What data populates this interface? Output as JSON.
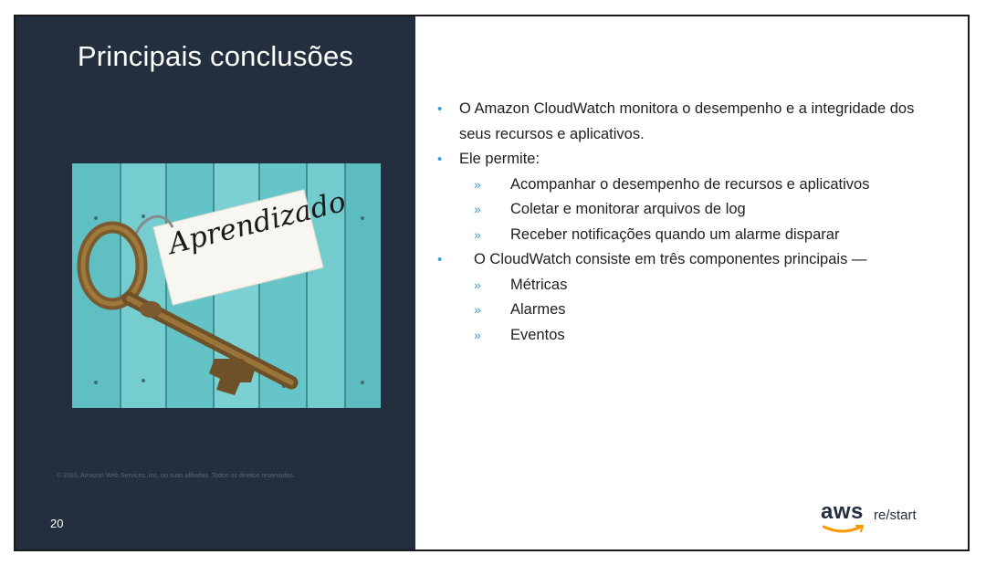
{
  "slide": {
    "title": "Principais conclusões",
    "image_label": "Aprendizado",
    "copyright": "© 2020, Amazon Web Services, Inc. ou suas afiliadas. Todos os direitos reservados.",
    "page_number": "20",
    "brand": {
      "logo_text": "aws",
      "suffix": "re/start"
    },
    "bullets": {
      "b1_line1": "O Amazon CloudWatch monitora o desempenho e a integridade dos",
      "b1_line2": "seus recursos e aplicativos.",
      "b2": "Ele permite:",
      "b2_sub": [
        "Acompanhar o desempenho de recursos e aplicativos",
        "Coletar e monitorar arquivos de log",
        "Receber notificações quando um alarme disparar"
      ],
      "b3": "O CloudWatch consiste em três componentes principais —",
      "b3_sub": [
        "Métricas",
        "Alarmes",
        "Eventos"
      ]
    },
    "bullet_glyph": "•",
    "sub_bullet_glyph": "»"
  },
  "colors": {
    "panel": "#232f3e",
    "accent": "#3a9ed6",
    "aws_orange": "#ff9900",
    "photo_teal": "#6cc7c9"
  }
}
